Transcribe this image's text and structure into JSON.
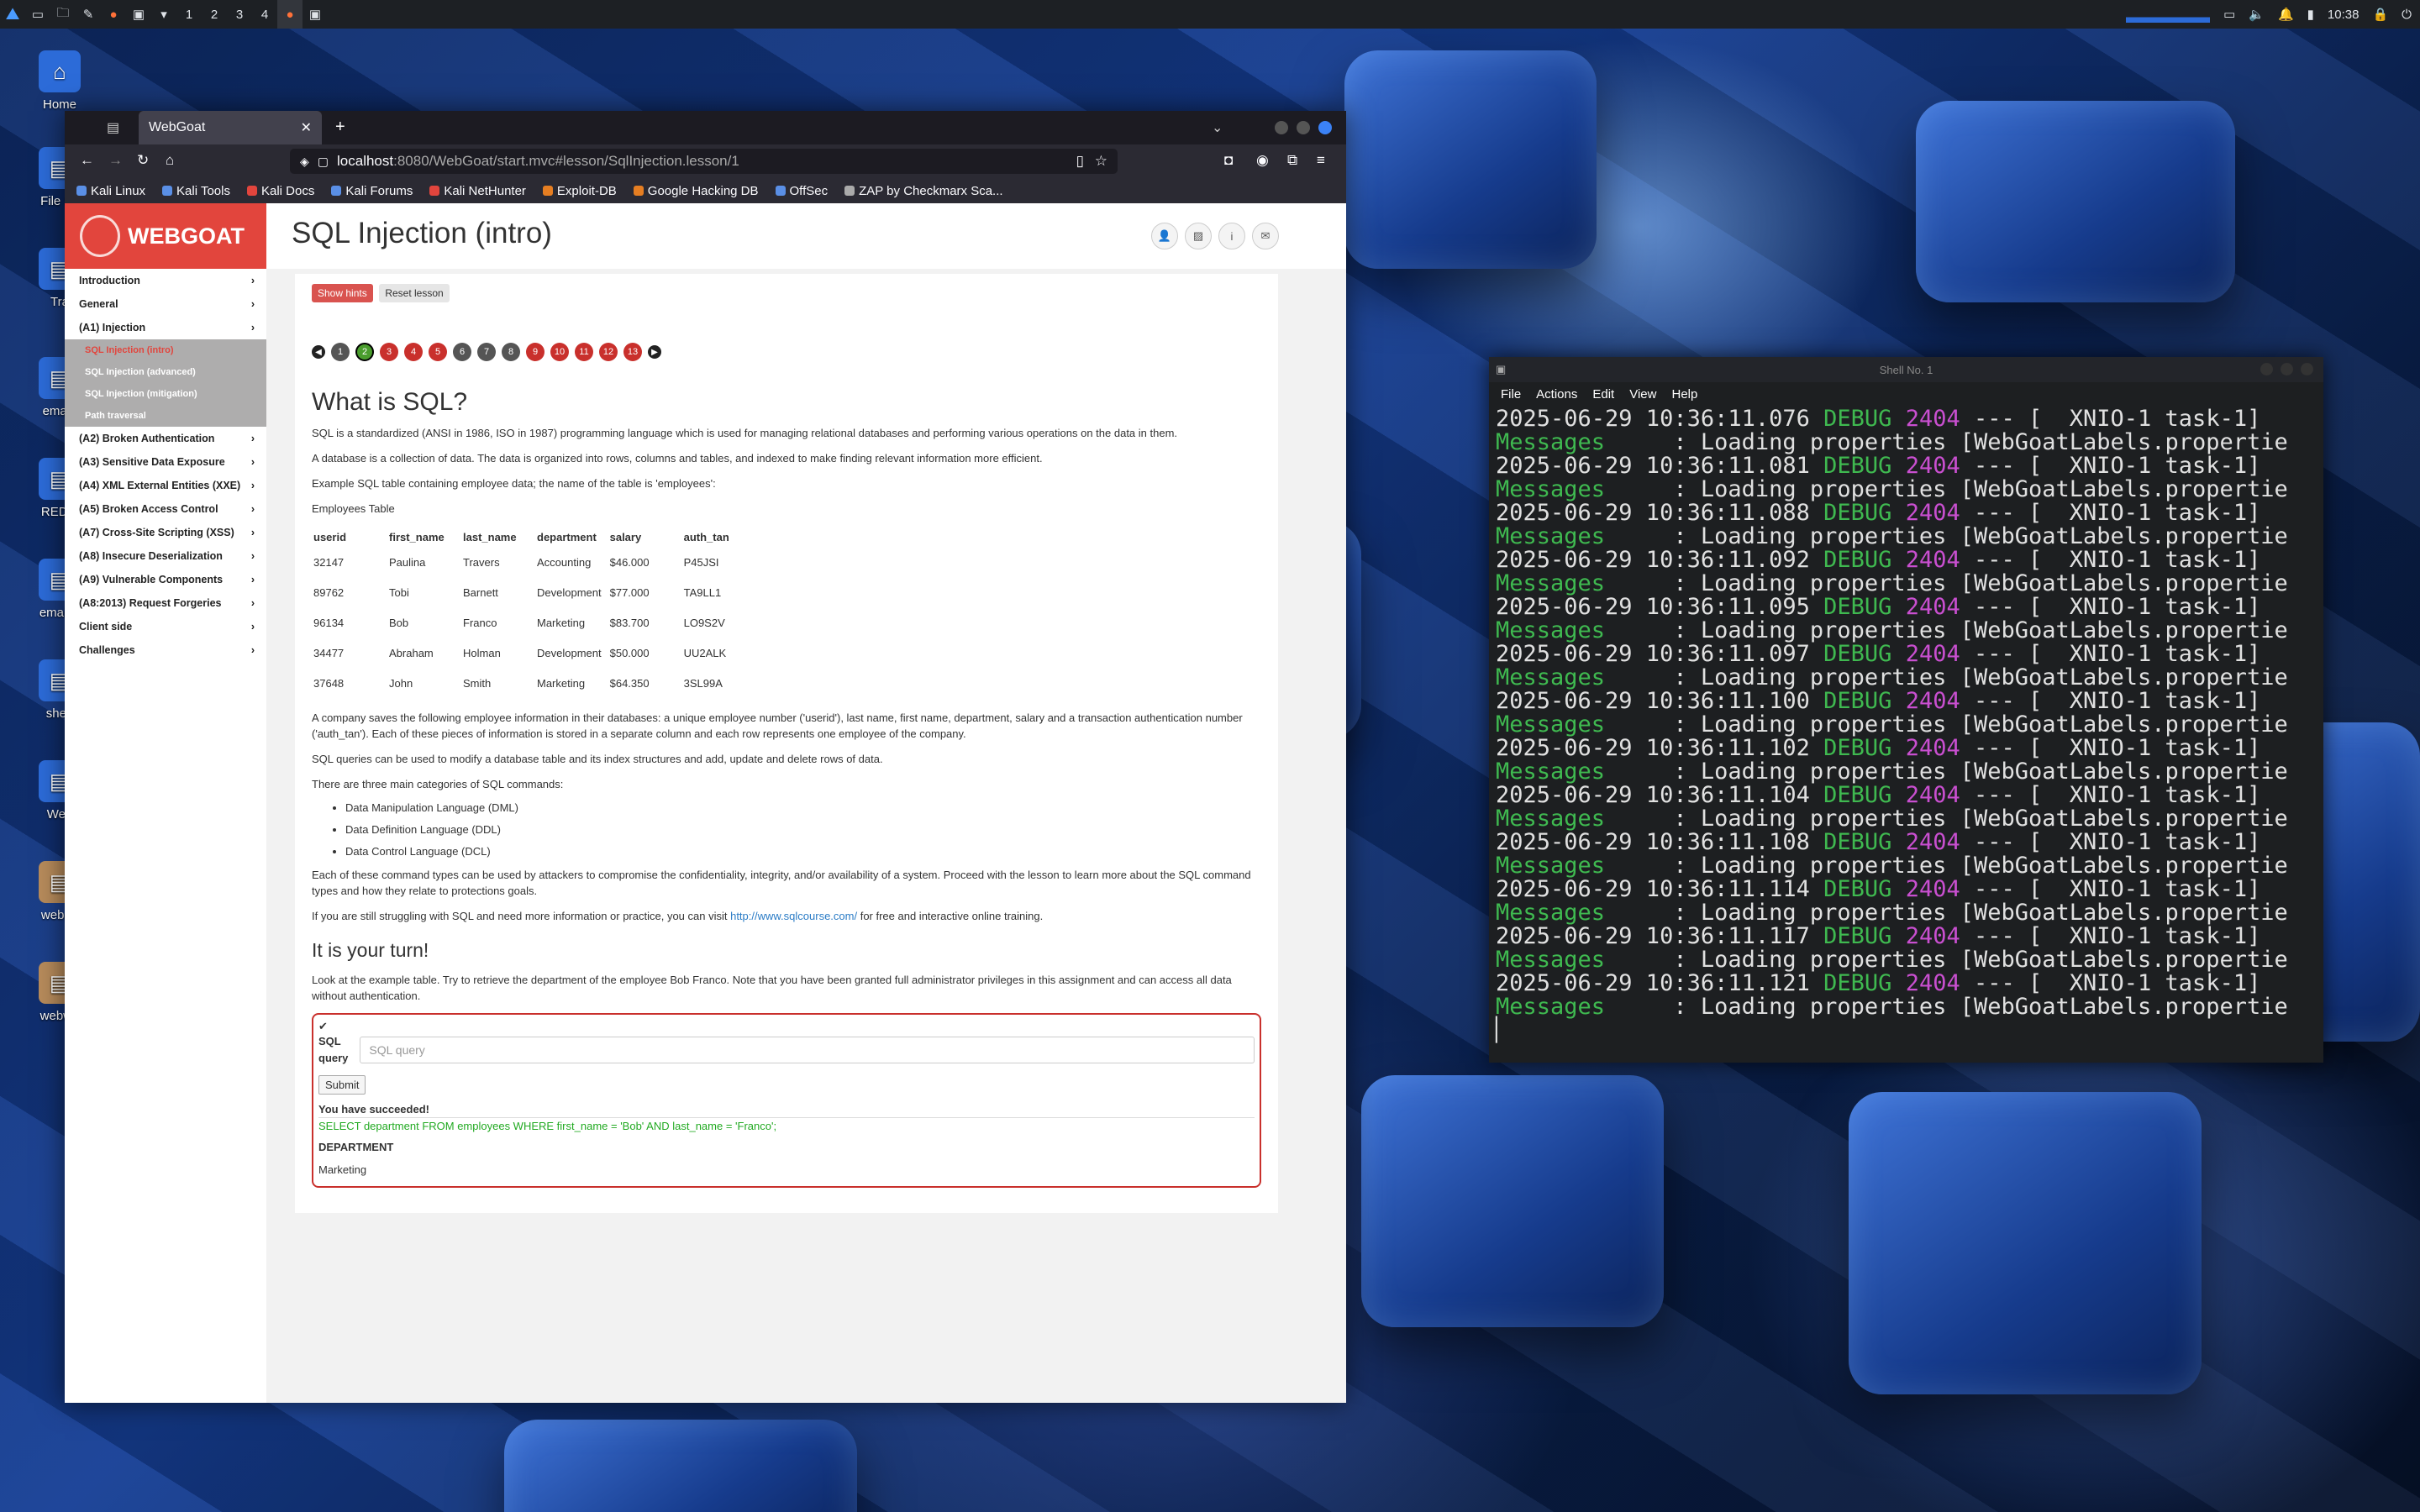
{
  "taskbar": {
    "workspaces": [
      "1",
      "2",
      "3",
      "4"
    ],
    "clock": "10:38"
  },
  "desktop": {
    "icons": [
      "Home",
      "File Sy",
      "Tra",
      "email-",
      "RED_I",
      "email-s",
      "sherl",
      "Web",
      "webgo",
      "webwo"
    ]
  },
  "browser": {
    "tab_title": "WebGoat",
    "url_host": "localhost",
    "url_rest": ":8080/WebGoat/start.mvc#lesson/SqlInjection.lesson/1",
    "bookmarks": [
      "Kali Linux",
      "Kali Tools",
      "Kali Docs",
      "Kali Forums",
      "Kali NetHunter",
      "Exploit-DB",
      "Google Hacking DB",
      "OffSec",
      "ZAP by Checkmarx Sca..."
    ]
  },
  "webgoat": {
    "logo": "WEBGOAT",
    "page_title": "SQL Injection (intro)",
    "menu": [
      {
        "label": "Introduction"
      },
      {
        "label": "General"
      },
      {
        "label": "(A1) Injection"
      }
    ],
    "submenu": [
      "SQL Injection (intro)",
      "SQL Injection (advanced)",
      "SQL Injection (mitigation)",
      "Path traversal"
    ],
    "menu_rest": [
      "(A2) Broken Authentication",
      "(A3) Sensitive Data Exposure",
      "(A4) XML External Entities (XXE)",
      "(A5) Broken Access Control",
      "(A7) Cross-Site Scripting (XSS)",
      "(A8) Insecure Deserialization",
      "(A9) Vulnerable Components",
      "(A8:2013) Request Forgeries",
      "Client side",
      "Challenges"
    ],
    "show_hints": "Show hints",
    "reset_lesson": "Reset lesson",
    "pages": [
      "1",
      "2",
      "3",
      "4",
      "5",
      "6",
      "7",
      "8",
      "9",
      "10",
      "11",
      "12",
      "13"
    ],
    "current_page": "2",
    "heading": "What is SQL?",
    "p1": "SQL is a standardized (ANSI in 1986, ISO in 1987) programming language which is used for managing relational databases and performing various operations on the data in them.",
    "p2": "A database is a collection of data. The data is organized into rows, columns and tables, and indexed to make finding relevant information more efficient.",
    "p3": "Example SQL table containing employee data; the name of the table is 'employees':",
    "table_caption": "Employees Table",
    "table_headers": [
      "userid",
      "first_name",
      "last_name",
      "department",
      "salary",
      "auth_tan"
    ],
    "table_rows": [
      [
        "32147",
        "Paulina",
        "Travers",
        "Accounting",
        "$46.000",
        "P45JSI"
      ],
      [
        "89762",
        "Tobi",
        "Barnett",
        "Development",
        "$77.000",
        "TA9LL1"
      ],
      [
        "96134",
        "Bob",
        "Franco",
        "Marketing",
        "$83.700",
        "LO9S2V"
      ],
      [
        "34477",
        "Abraham",
        "Holman",
        "Development",
        "$50.000",
        "UU2ALK"
      ],
      [
        "37648",
        "John",
        "Smith",
        "Marketing",
        "$64.350",
        "3SL99A"
      ]
    ],
    "p4": "A company saves the following employee information in their databases: a unique employee number ('userid'), last name, first name, department, salary and a transaction authentication number ('auth_tan'). Each of these pieces of information is stored in a separate column and each row represents one employee of the company.",
    "p5": "SQL queries can be used to modify a database table and its index structures and add, update and delete rows of data.",
    "p6": "There are three main categories of SQL commands:",
    "categories": [
      "Data Manipulation Language (DML)",
      "Data Definition Language (DDL)",
      "Data Control Language (DCL)"
    ],
    "p7": "Each of these command types can be used by attackers to compromise the confidentiality, integrity, and/or availability of a system. Proceed with the lesson to learn more about the SQL command types and how they relate to protections goals.",
    "p8_before": "If you are still struggling with SQL and need more information or practice, you can visit ",
    "p8_link": "http://www.sqlcourse.com/",
    "p8_after": " for free and interactive online training.",
    "turn_heading": "It is your turn!",
    "turn_text": "Look at the example table. Try to retrieve the department of the employee Bob Franco. Note that you have been granted full administrator privileges in this assignment and can access all data without authentication.",
    "sql_label_1": "SQL",
    "sql_label_2": "query",
    "sql_placeholder": "SQL query",
    "submit": "Submit",
    "success": "You have succeeded!",
    "executed_query": "SELECT department FROM employees WHERE first_name = 'Bob' AND last_name = 'Franco';",
    "result_header": "DEPARTMENT",
    "result_value": "Marketing"
  },
  "terminal": {
    "title": "Shell No. 1",
    "menu": [
      "File",
      "Actions",
      "Edit",
      "View",
      "Help"
    ],
    "timestamps": [
      "2025-06-29 10:36:11.076",
      "2025-06-29 10:36:11.081",
      "2025-06-29 10:36:11.088",
      "2025-06-29 10:36:11.092",
      "2025-06-29 10:36:11.095",
      "2025-06-29 10:36:11.097",
      "2025-06-29 10:36:11.100",
      "2025-06-29 10:36:11.102",
      "2025-06-29 10:36:11.104",
      "2025-06-29 10:36:11.108",
      "2025-06-29 10:36:11.114",
      "2025-06-29 10:36:11.117",
      "2025-06-29 10:36:11.121"
    ],
    "level": "DEBUG",
    "pid": "2404",
    "thread": "--- [  XNIO-1 task-1]",
    "logger": "Messages",
    "message": "     : Loading properties [WebGoatLabels.propertie"
  }
}
